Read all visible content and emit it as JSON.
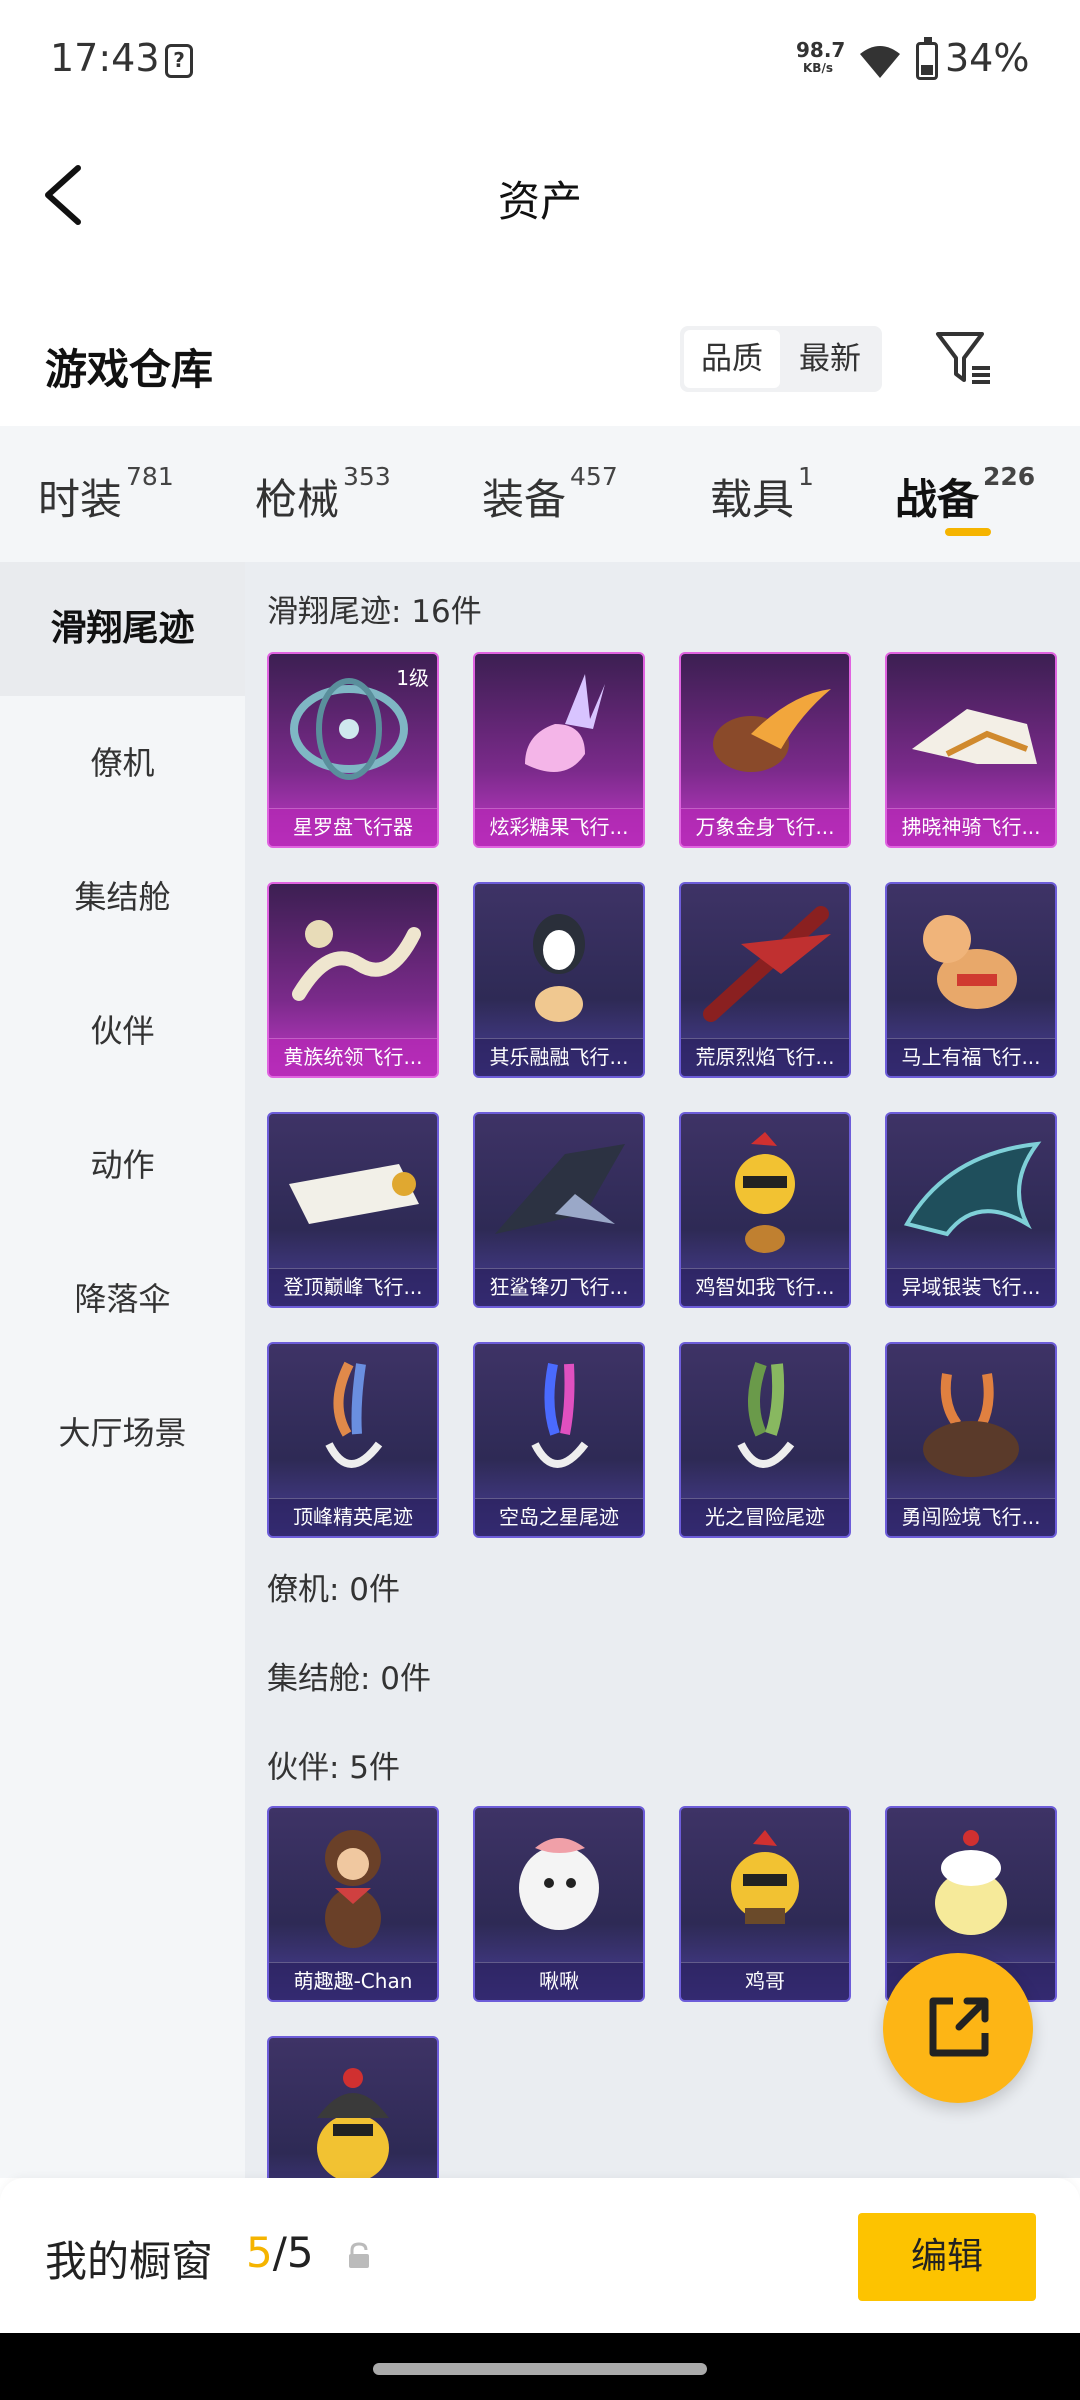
{
  "status": {
    "time": "17:43",
    "speed_value": "98.7",
    "speed_unit": "KB/s",
    "battery": "34%"
  },
  "header": {
    "title": "资产"
  },
  "section": {
    "title": "游戏仓库",
    "sort_options": [
      "品质",
      "最新"
    ]
  },
  "tabs": [
    {
      "label": "时装",
      "count": "781"
    },
    {
      "label": "枪械",
      "count": "353"
    },
    {
      "label": "装备",
      "count": "457"
    },
    {
      "label": "载具",
      "count": "1"
    },
    {
      "label": "战备",
      "count": "226"
    }
  ],
  "sidebar": [
    "滑翔尾迹",
    "僚机",
    "集结舱",
    "伙伴",
    "动作",
    "降落伞",
    "大厅场景"
  ],
  "groups": {
    "glide": {
      "title": "滑翔尾迹: 16件"
    },
    "wingman": {
      "title": "僚机: 0件"
    },
    "pod": {
      "title": "集结舱: 0件"
    },
    "partner": {
      "title": "伙伴: 5件"
    }
  },
  "glide_items": [
    {
      "name": "星罗盘飞行器",
      "level": "1级"
    },
    {
      "name": "炫彩糖果飞行..."
    },
    {
      "name": "万象金身飞行..."
    },
    {
      "name": "拂晓神骑飞行..."
    },
    {
      "name": "黄族统领飞行..."
    },
    {
      "name": "其乐融融飞行..."
    },
    {
      "name": "荒原烈焰飞行..."
    },
    {
      "name": "马上有福飞行..."
    },
    {
      "name": "登顶巅峰飞行..."
    },
    {
      "name": "狂鲨锋刃飞行..."
    },
    {
      "name": "鸡智如我飞行..."
    },
    {
      "name": "异域银装飞行..."
    },
    {
      "name": "顶峰精英尾迹"
    },
    {
      "name": "空岛之星尾迹"
    },
    {
      "name": "光之冒险尾迹"
    },
    {
      "name": "勇闯险境飞行..."
    }
  ],
  "partner_items": [
    {
      "name": "萌趣趣-Chan"
    },
    {
      "name": "啾啾"
    },
    {
      "name": "鸡哥"
    },
    {
      "name": ""
    },
    {
      "name": ""
    }
  ],
  "showcase": {
    "label": "我的橱窗",
    "current": "5",
    "sep": "/",
    "total": "5",
    "edit_label": "编辑"
  },
  "colors": {
    "accent": "#f5b400",
    "button": "#fdc300",
    "card_purple": "#4a3f9a",
    "card_pink": "#c33ac9"
  }
}
